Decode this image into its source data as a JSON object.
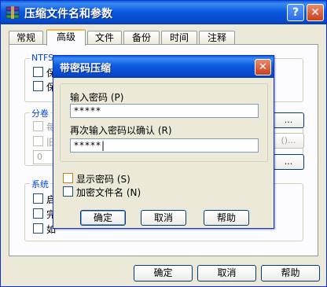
{
  "window": {
    "title": "压缩文件名和参数",
    "help_glyph": "?",
    "close_glyph": "✕"
  },
  "tabs": [
    {
      "label": "常规"
    },
    {
      "label": "高级"
    },
    {
      "label": "文件"
    },
    {
      "label": "备份"
    },
    {
      "label": "时间"
    },
    {
      "label": "注释"
    }
  ],
  "panel": {
    "ntfs_group_label": "NTFS",
    "ntfs_items": [
      "保",
      "保"
    ],
    "split_group_label": "分卷",
    "split_items": [
      "每",
      "旧"
    ],
    "split_value": "0",
    "system_group_label": "系统",
    "system_items": [
      "启",
      "完",
      "如"
    ],
    "right_button_ellipsis": "...",
    "right_button2_text": "()...",
    "right_button3_ellipsis": "..."
  },
  "bottom_buttons": {
    "ok": "确定",
    "cancel": "取消",
    "help": "帮助"
  },
  "dialog": {
    "title": "带密码压缩",
    "close_glyph": "✕",
    "password_label": "输入密码 (P)",
    "password_value": "*****",
    "confirm_label": "再次输入密码以确认 (R)",
    "confirm_value": "*****|",
    "show_password_label": "显示密码 (S)",
    "encrypt_names_label": "加密文件名 (N)",
    "ok": "确定",
    "cancel": "取消",
    "help": "帮助"
  }
}
